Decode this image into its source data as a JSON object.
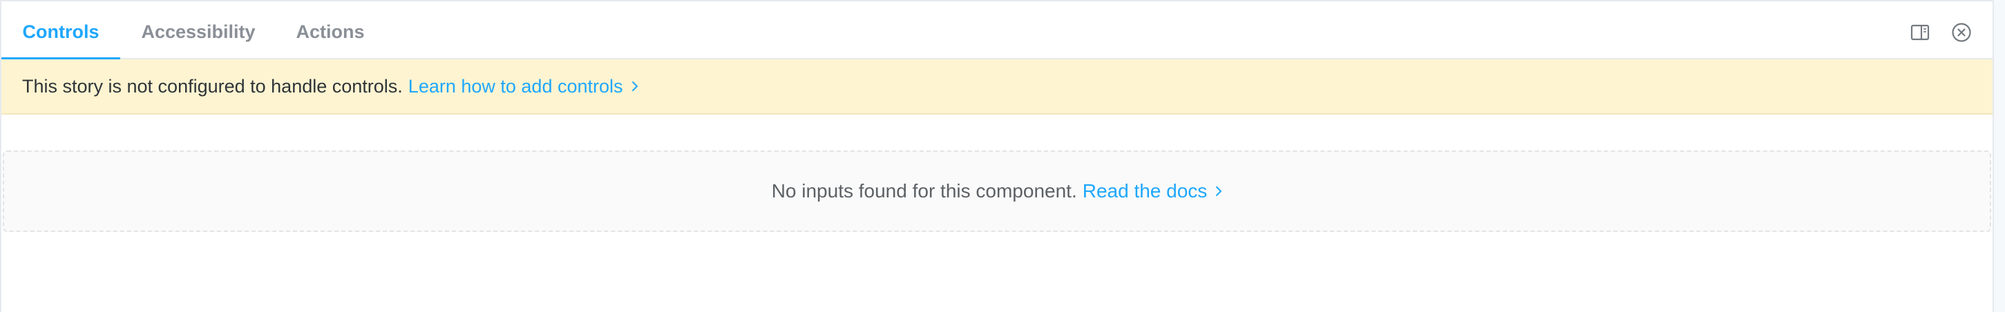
{
  "tabs": [
    {
      "label": "Controls",
      "active": true
    },
    {
      "label": "Accessibility",
      "active": false
    },
    {
      "label": "Actions",
      "active": false
    }
  ],
  "toolbar": {
    "panel_icon": "panel-orientation-icon",
    "close_icon": "close-circle-icon"
  },
  "banner": {
    "message": "This story is not configured to handle controls.",
    "link_label": "Learn how to add controls",
    "link_icon": "chevron-right-icon"
  },
  "empty_state": {
    "message": "No inputs found for this component.",
    "link_label": "Read the docs",
    "link_icon": "chevron-right-icon"
  },
  "colors": {
    "accent": "#1ea7fd",
    "banner_bg": "#fef4d1",
    "tab_inactive": "#8a8f97"
  }
}
